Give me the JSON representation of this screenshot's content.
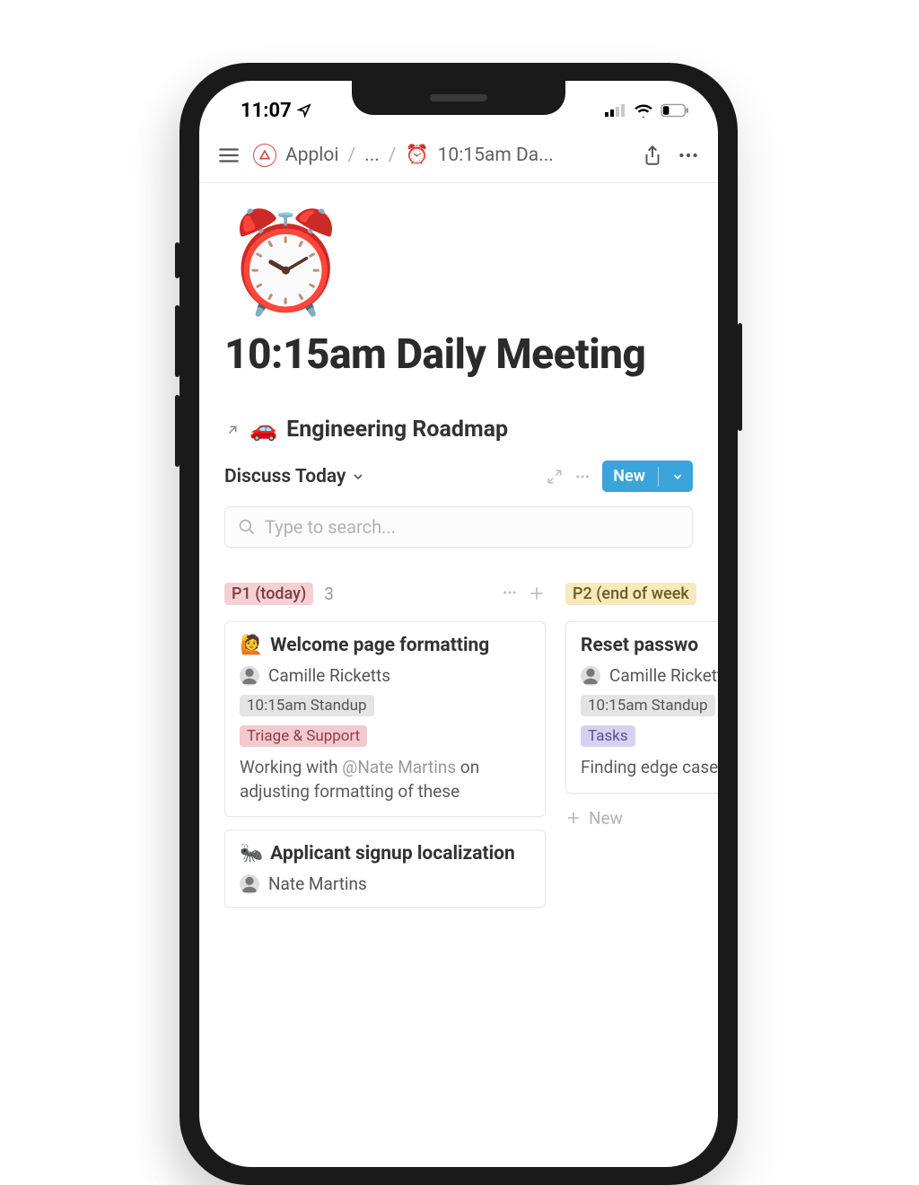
{
  "status": {
    "time": "11:07"
  },
  "breadcrumb": {
    "workspace": "Apploi",
    "title": "10:15am Da..."
  },
  "page": {
    "icon": "⏰",
    "title": "10:15am Daily Meeting",
    "linked": {
      "icon": "🚗",
      "label": "Engineering Roadmap"
    },
    "view": {
      "label": "Discuss Today"
    },
    "newButton": "New",
    "search": {
      "placeholder": "Type to search..."
    }
  },
  "board": {
    "columns": [
      {
        "label": "P1 (today)",
        "count": "3",
        "cards": [
          {
            "icon": "🙋",
            "title": "Welcome page formatting",
            "person": "Camille Ricketts",
            "tag1": "10:15am Standup",
            "tag2": "Triage & Support",
            "desc_pre": "Working with ",
            "mention": "@Nate Martins",
            "desc_post": " on adjusting formatting of these"
          },
          {
            "icon": "🐜",
            "title": "Applicant signup localization",
            "person": "Nate Martins"
          }
        ]
      },
      {
        "label": "P2 (end of week",
        "cards": [
          {
            "title": "Reset passwo",
            "person": "Camille Rickett",
            "tag1": "10:15am Standup",
            "tag2": "Tasks",
            "desc": "Finding edge case"
          }
        ],
        "newLabel": "New"
      }
    ]
  }
}
